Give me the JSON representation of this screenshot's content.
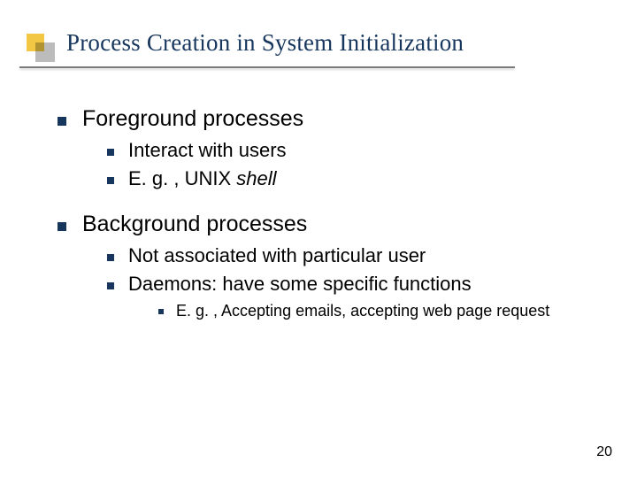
{
  "title": "Process Creation in System Initialization",
  "sections": [
    {
      "heading": "Foreground processes",
      "items": [
        {
          "text": "Interact with users"
        },
        {
          "prefix": "E. g. , UNIX ",
          "italic": "shell"
        }
      ]
    },
    {
      "heading": "Background processes",
      "items": [
        {
          "text": "Not associated with particular user"
        },
        {
          "text": "Daemons: have some specific functions",
          "sub": [
            {
              "text": "E. g. , Accepting emails, accepting web page request"
            }
          ]
        }
      ]
    }
  ],
  "page_number": "20"
}
